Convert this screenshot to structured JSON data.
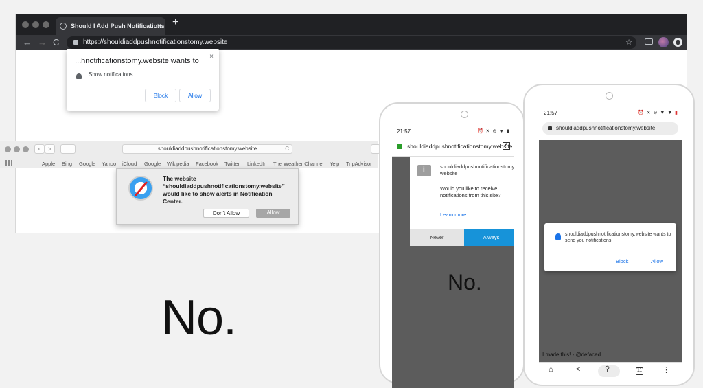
{
  "chrome": {
    "tab_title": "Should I Add Push Notifications?",
    "tab_close": "×",
    "new_tab": "+",
    "back": "←",
    "forward": "→",
    "reload": "C",
    "url": "https://shouldiaddpushnotificationstomy.website",
    "star": "☆",
    "popup": {
      "title": "...hnotificationstomy.website wants to",
      "close": "×",
      "permission": "Show notifications",
      "block_label": "Block",
      "allow_label": "Allow"
    }
  },
  "safari": {
    "back": "<",
    "forward": ">",
    "url": "shouldiaddpushnotificationstomy.website",
    "reload": "C",
    "bookmarks": [
      "Apple",
      "Bing",
      "Google",
      "Yahoo",
      "iCloud",
      "Google",
      "Wikipedia",
      "Facebook",
      "Twitter",
      "LinkedIn",
      "The Weather Channel",
      "Yelp",
      "TripAdvisor"
    ],
    "dialog": {
      "message": "The website “shouldiaddpushnotificationstomy.website” would like to show alerts in Notification Center.",
      "dont_allow_label": "Don't Allow",
      "allow_label": "Allow"
    }
  },
  "main_answer": "No.",
  "phone_left": {
    "time": "21:57",
    "url": "shouldiaddpushnotificationstomy.website",
    "tab_count": "6",
    "dialog": {
      "host": "shouldiaddpushnotificationstomy.website",
      "question": "Would you like to receive notifications from this site?",
      "learn_more": "Learn more",
      "never_label": "Never",
      "always_label": "Always"
    },
    "answer": "No."
  },
  "phone_right": {
    "time": "21:57",
    "url": "shouldiaddpushnotificationstomy.website",
    "dialog": {
      "text": "shouldiaddpushnotificationstomy.website wants to send you notifications",
      "block_label": "Block",
      "allow_label": "Allow"
    },
    "credit": "I made this! - @defaced",
    "tab_count": "11"
  },
  "colors": {
    "chrome_dark": "#202124",
    "google_blue": "#1a73e8",
    "firefox_always_blue": "#1793d9",
    "mobile_bg": "#5c5c5c"
  },
  "icons": [
    "globe-icon",
    "lock-icon",
    "bell-icon",
    "star-icon",
    "cast-icon",
    "safari-compass-icon",
    "info-icon",
    "home-icon",
    "share-icon",
    "search-icon",
    "tabs-icon",
    "menu-icon"
  ]
}
